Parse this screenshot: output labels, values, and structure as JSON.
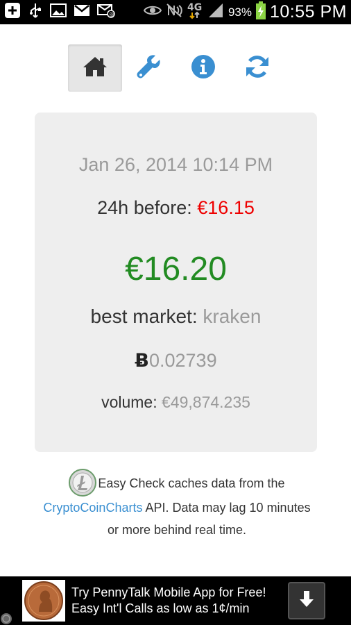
{
  "status_bar": {
    "icons_left": [
      "plus-icon",
      "usb-icon",
      "image-icon",
      "gmail-icon",
      "email-icon"
    ],
    "icons_right": [
      "eye-icon",
      "no-nfc-icon",
      "4g-icon",
      "signal-icon",
      "battery-charging-icon"
    ],
    "network": "4G",
    "battery_percent": "93%",
    "time": "10:55 PM"
  },
  "nav": {
    "items": [
      {
        "icon": "home-icon",
        "active": true
      },
      {
        "icon": "wrench-icon",
        "active": false
      },
      {
        "icon": "info-icon",
        "active": false
      },
      {
        "icon": "refresh-icon",
        "active": false
      }
    ],
    "accent_color": "#3a8fd1"
  },
  "ticker": {
    "timestamp": "Jan 26, 2014 10:14 PM",
    "before_label": "24h before: ",
    "before_value": "€16.15",
    "price": "€16.20",
    "market_label": "best market: ",
    "market_value": "kraken",
    "btc_symbol": "Ƀ",
    "btc_value": "0.02739",
    "volume_label": "volume: ",
    "volume_value": "€49,874.235",
    "colors": {
      "down": "#ee0000",
      "price": "#228b22",
      "muted": "#9a9a9a"
    }
  },
  "note": {
    "logo_icon": "litecoin-logo-icon",
    "text_1": "Easy Check caches data from the",
    "link": "CryptoCoinCharts",
    "text_2": " API. Data may lag 10 minutes or more behind real time."
  },
  "ad": {
    "image_icon": "penny-coin-image",
    "line_1": "Try PennyTalk Mobile App for Free!",
    "line_2": "Easy Int'l Calls as low as 1¢/min",
    "download_icon": "download-arrow-icon"
  }
}
